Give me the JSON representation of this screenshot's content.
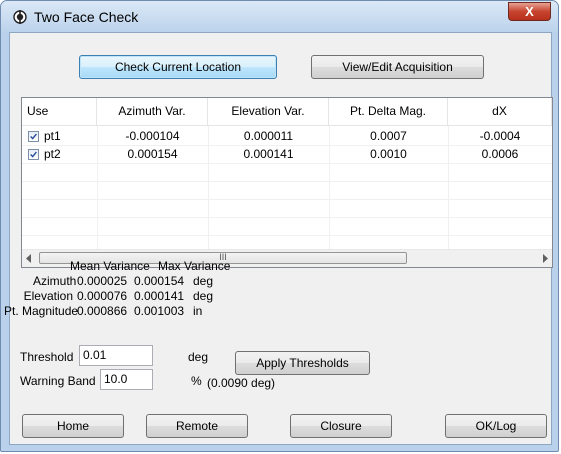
{
  "window": {
    "title": "Two Face Check",
    "close_label": "X"
  },
  "buttons": {
    "check_current_location": "Check Current Location",
    "view_edit_acquisition": "View/Edit Acquisition",
    "apply_thresholds": "Apply Thresholds",
    "home": "Home",
    "remote": "Remote",
    "closure": "Closure",
    "ok_log": "OK/Log"
  },
  "table": {
    "columns": [
      "Use",
      "Azimuth Var.",
      "Elevation Var.",
      "Pt. Delta Mag.",
      "dX"
    ],
    "rows": [
      {
        "checked": true,
        "name": "pt1",
        "azimuth_var": "-0.000104",
        "elevation_var": "0.000011",
        "pt_delta_mag": "0.0007",
        "dx": "-0.0004"
      },
      {
        "checked": true,
        "name": "pt2",
        "azimuth_var": "0.000154",
        "elevation_var": "0.000141",
        "pt_delta_mag": "0.0010",
        "dx": "0.0006"
      }
    ],
    "scroll_grip": "III"
  },
  "stats": {
    "header_mean": "Mean Variance",
    "header_max": "Max Variance",
    "rows": [
      {
        "label": "Azimuth",
        "mean": "0.000025",
        "max": "0.000154",
        "unit": "deg"
      },
      {
        "label": "Elevation",
        "mean": "0.000076",
        "max": "0.000141",
        "unit": "deg"
      },
      {
        "label": "Pt. Magnitude",
        "mean": "0.000866",
        "max": "0.001003",
        "unit": "in"
      }
    ]
  },
  "threshold": {
    "label": "Threshold",
    "value": "0.01",
    "unit": "deg"
  },
  "warning_band": {
    "label": "Warning Band",
    "value": "10.0",
    "unit": "%",
    "computed": "(0.0090 deg)"
  }
}
